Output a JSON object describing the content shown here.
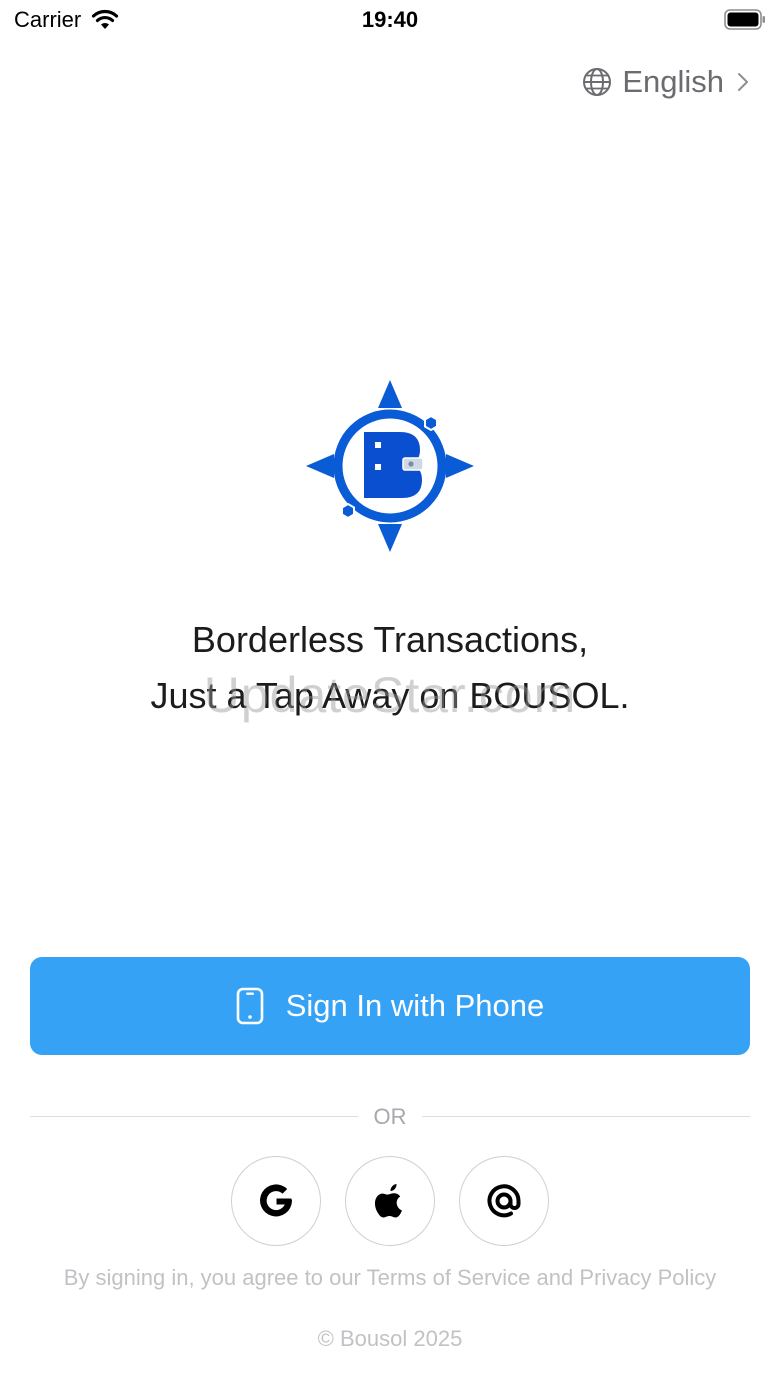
{
  "status_bar": {
    "carrier": "Carrier",
    "time": "19:40"
  },
  "language": {
    "label": "English",
    "icon": "globe-icon"
  },
  "logo": {
    "name": "bousol-compass-logo"
  },
  "tagline": {
    "line1": "Borderless Transactions,",
    "line2": "Just a Tap Away on BOUSOL."
  },
  "watermark": "UpdateStar.com",
  "phone_signin": {
    "label": "Sign In with Phone",
    "icon": "phone-icon"
  },
  "divider": {
    "label": "OR"
  },
  "social": [
    {
      "name": "google",
      "icon": "google-icon"
    },
    {
      "name": "apple",
      "icon": "apple-icon"
    },
    {
      "name": "email",
      "icon": "at-sign-icon"
    }
  ],
  "footer": {
    "terms": "By signing in, you agree to our Terms of Service and Privacy Policy",
    "copyright": "© Bousol 2025"
  },
  "colors": {
    "primary": "#35a2f6",
    "brand_blue": "#0a5cd6",
    "muted_text": "#c2c2c6"
  }
}
